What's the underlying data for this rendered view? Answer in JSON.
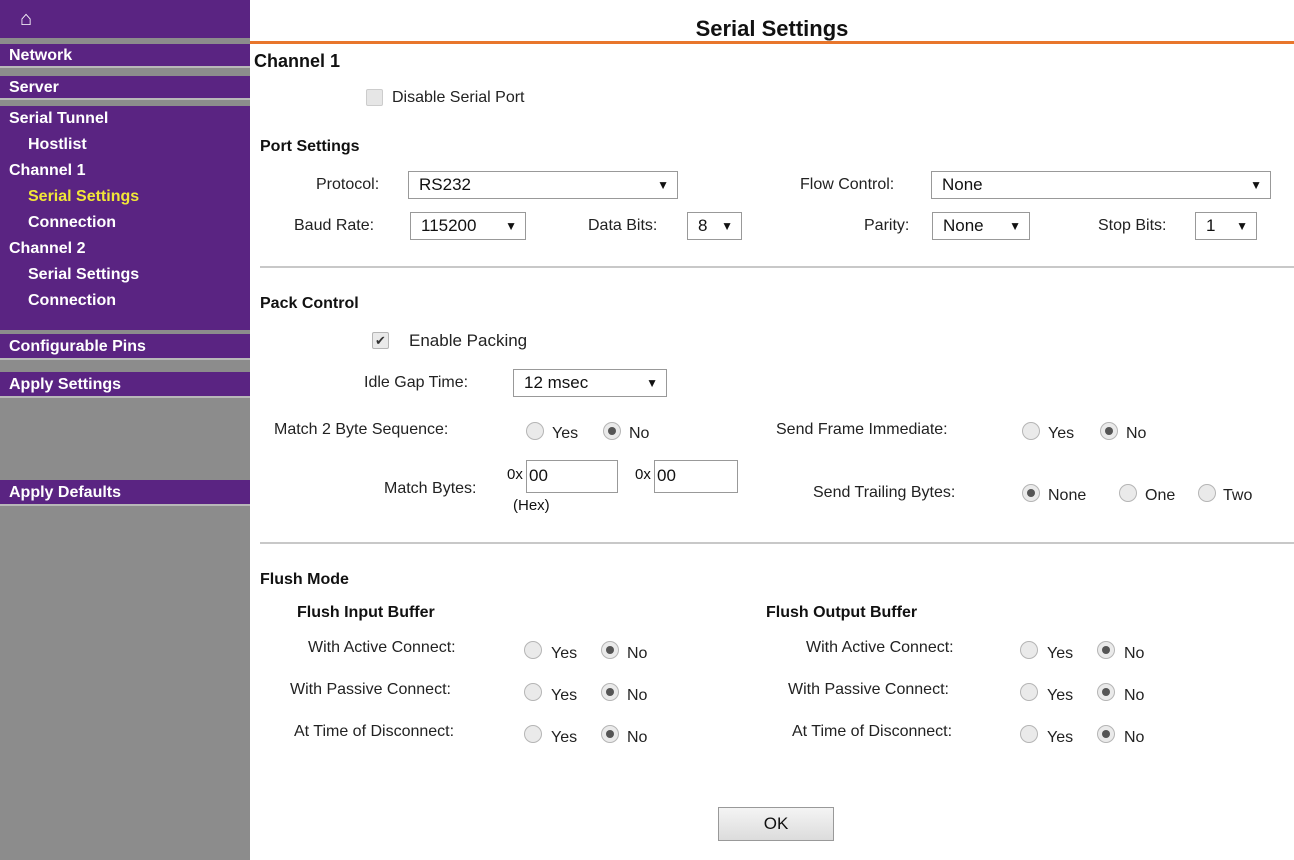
{
  "sidebar": {
    "home_icon": "home-icon",
    "network": "Network",
    "server": "Server",
    "serial_tunnel": {
      "label": "Serial Tunnel",
      "hostlist": "Hostlist"
    },
    "channel1": {
      "label": "Channel 1",
      "serial_settings": "Serial Settings",
      "connection": "Connection"
    },
    "channel2": {
      "label": "Channel 2",
      "serial_settings": "Serial Settings",
      "connection": "Connection"
    },
    "configurable_pins": "Configurable Pins",
    "apply_settings": "Apply Settings",
    "apply_defaults": "Apply Defaults"
  },
  "colors": {
    "nav_bg": "#5a2482",
    "nav_active": "#f1e637",
    "title_underline": "#e8762c",
    "sidebar_bg": "#8c8c8c"
  },
  "page_title": "Serial Settings",
  "channel_heading": "Channel 1",
  "disable_serial_port": {
    "label": "Disable Serial Port",
    "checked": false
  },
  "port_settings": {
    "heading": "Port Settings",
    "protocol_label": "Protocol:",
    "protocol_value": "RS232",
    "flow_control_label": "Flow Control:",
    "flow_control_value": "None",
    "baud_rate_label": "Baud Rate:",
    "baud_rate_value": "115200",
    "data_bits_label": "Data Bits:",
    "data_bits_value": "8",
    "parity_label": "Parity:",
    "parity_value": "None",
    "stop_bits_label": "Stop Bits:",
    "stop_bits_value": "1"
  },
  "pack_control": {
    "heading": "Pack Control",
    "enable_packing": {
      "label": "Enable Packing",
      "checked": true
    },
    "idle_gap_label": "Idle Gap Time:",
    "idle_gap_value": "12 msec",
    "match2_label": "Match 2 Byte Sequence:",
    "match2_selected": "No",
    "send_frame_label": "Send Frame Immediate:",
    "send_frame_selected": "No",
    "match_bytes_label": "Match Bytes:",
    "prefix": "0x",
    "match_byte1": "00",
    "match_byte2": "00",
    "hex_note": "(Hex)",
    "trailing_label": "Send Trailing Bytes:",
    "trailing_options": [
      "None",
      "One",
      "Two"
    ],
    "trailing_selected": "None",
    "yes": "Yes",
    "no": "No"
  },
  "flush_mode": {
    "heading": "Flush Mode",
    "input_heading": "Flush Input Buffer",
    "output_heading": "Flush Output Buffer",
    "rows": [
      {
        "label": "With Active Connect:",
        "input": "No",
        "output": "No"
      },
      {
        "label": "With Passive Connect:",
        "input": "No",
        "output": "No"
      },
      {
        "label": "At Time of Disconnect:",
        "input": "No",
        "output": "No"
      }
    ],
    "yes": "Yes",
    "no": "No"
  },
  "ok_button": "OK"
}
